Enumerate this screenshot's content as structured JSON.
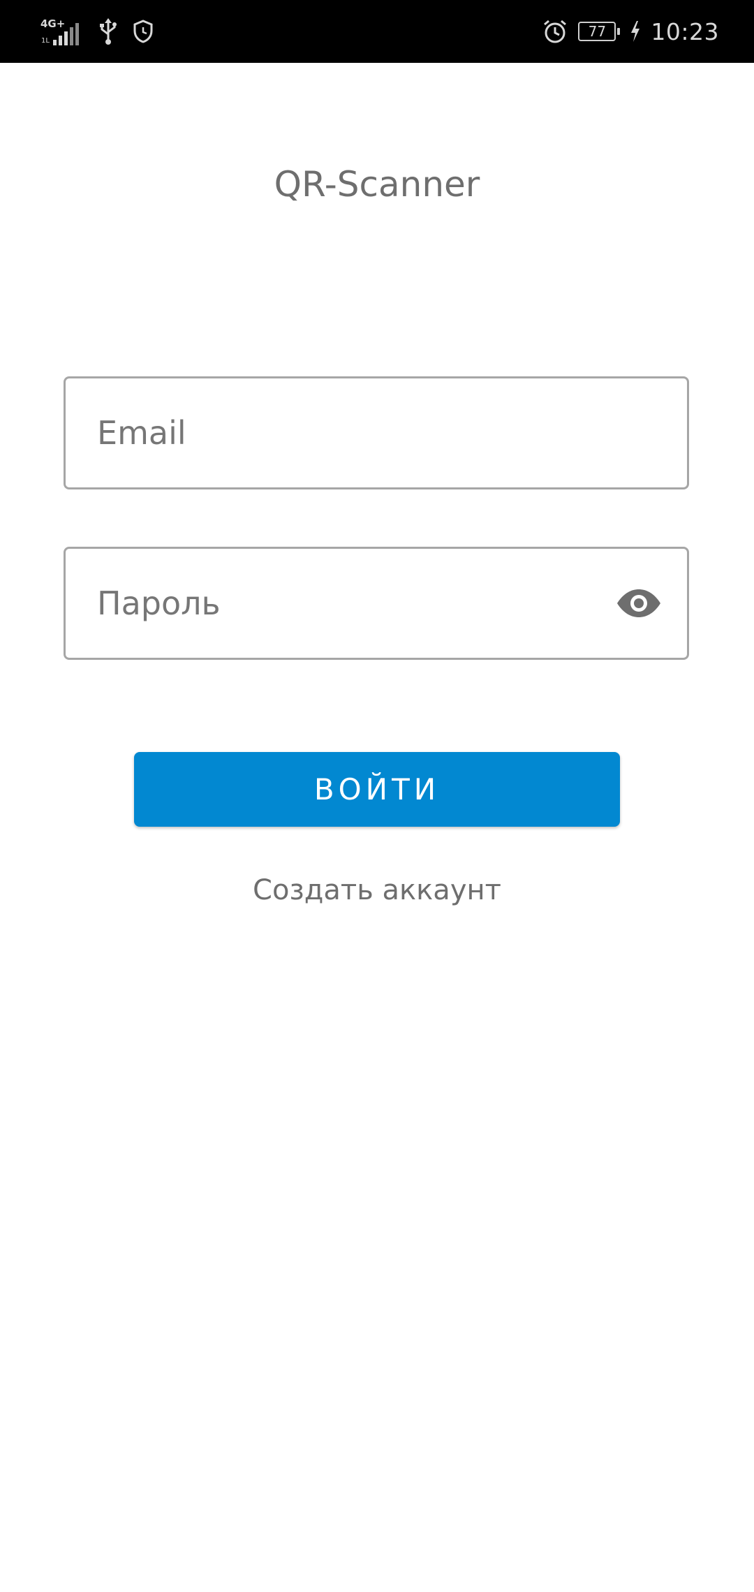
{
  "status_bar": {
    "network_type": "4G+",
    "battery_level": "77",
    "time": "10:23",
    "icons": [
      "signal-icon",
      "usb-icon",
      "shield-icon",
      "alarm-icon",
      "battery-icon",
      "charging-icon"
    ]
  },
  "app": {
    "title": "QR-Scanner"
  },
  "login_form": {
    "email_placeholder": "Email",
    "email_value": "",
    "password_placeholder": "Пароль",
    "password_value": "",
    "password_toggle_icon": "eye-icon",
    "login_button_label": "ВОЙТИ",
    "create_account_label": "Создать аккаунт"
  },
  "colors": {
    "primary": "#0288d1",
    "status_bar_bg": "#000000",
    "text_gray": "#6e6e6e",
    "field_border": "#a6a6a6"
  }
}
